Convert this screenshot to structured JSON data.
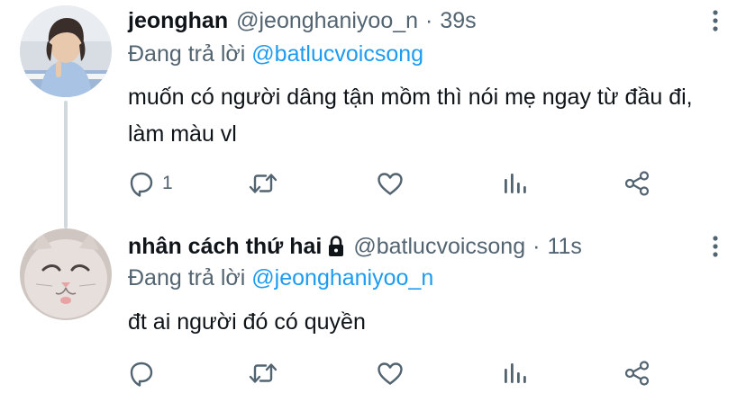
{
  "colors": {
    "text_primary": "#0f1419",
    "text_secondary": "#536471",
    "mention": "#1d9bf0",
    "thread_line": "#cfd9de"
  },
  "tweets": [
    {
      "display_name": "jeonghan",
      "handle": "@jeonghaniyoo_n",
      "separator": "·",
      "time": "39s",
      "protected": false,
      "reply_prefix": "Đang trả lời",
      "reply_to": "@batlucvoicsong",
      "text": "muốn có người dâng tận mồm thì nói mẹ ngay từ đầu đi, làm màu vl",
      "reply_count": "1",
      "icons": [
        "more-icon",
        "reply-icon",
        "retweet-icon",
        "like-icon",
        "stats-icon",
        "share-icon"
      ]
    },
    {
      "display_name": "nhân cách thứ hai",
      "handle": "@batlucvoicsong",
      "separator": "·",
      "time": "11s",
      "protected": true,
      "reply_prefix": "Đang trả lời",
      "reply_to": "@jeonghaniyoo_n",
      "text": "đt ai người đó có quyền",
      "reply_count": "",
      "icons": [
        "lock-icon",
        "more-icon",
        "reply-icon",
        "retweet-icon",
        "like-icon",
        "stats-icon",
        "share-icon"
      ]
    }
  ]
}
